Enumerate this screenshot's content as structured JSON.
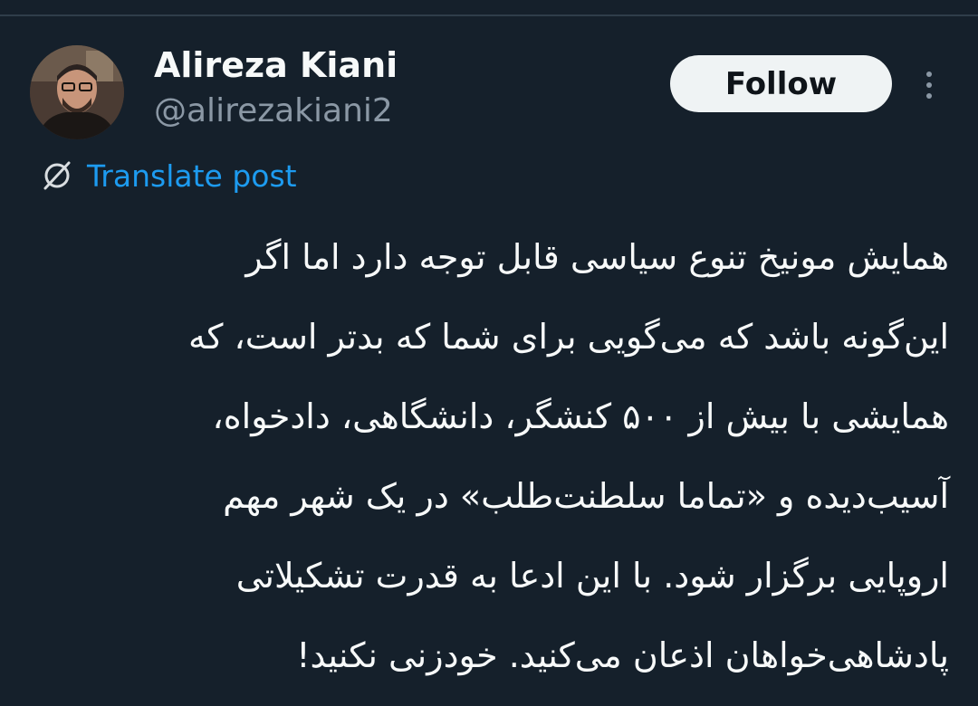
{
  "author": {
    "display_name": "Alireza Kiani",
    "handle": "@alirezakiani2"
  },
  "actions": {
    "follow_label": "Follow",
    "more_icon": "more-vertical-icon"
  },
  "translate": {
    "label": "Translate post",
    "icon": "globe-translate-icon"
  },
  "post": {
    "lines": [
      "همایش مونیخ تنوع سیاسی قابل توجه دارد اما اگر",
      "این‌گونه باشد که می‌گویی برای شما که بدتر است، که",
      "همایشی با بیش از ۵۰۰ کنشگر، دانشگاهی، دادخواه،",
      "آسیب‌دیده و «تماما سلطنت‌طلب» در یک شهر مهم",
      "اروپایی برگزار شود. با این ادعا به قدرت تشکیلاتی",
      "پادشاهی‌خواهان اذعان می‌کنید. خودزنی نکنید!"
    ]
  },
  "colors": {
    "background": "#15202b",
    "text_primary": "#f7f9f9",
    "text_secondary": "#8b98a5",
    "link": "#1d9bf0",
    "button_bg": "#eff3f4"
  }
}
